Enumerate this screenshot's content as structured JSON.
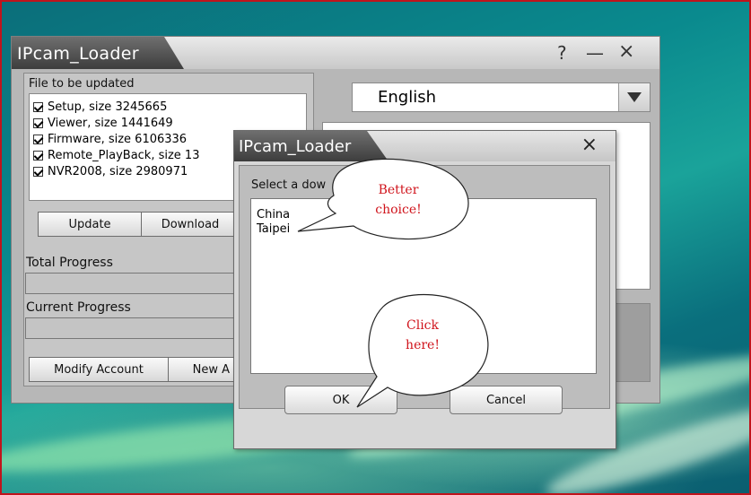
{
  "main_window": {
    "title": "IPcam_Loader",
    "controls": {
      "help": "?",
      "minimize": "—",
      "close": "×"
    },
    "file_section_label": "File to be updated",
    "files": [
      {
        "label": "Setup, size 3245665",
        "checked": true
      },
      {
        "label": "Viewer, size 1441649",
        "checked": true
      },
      {
        "label": "Firmware, size 6106336",
        "checked": true
      },
      {
        "label": "Remote_PlayBack, size 13",
        "checked": true
      },
      {
        "label": "NVR2008, size 2980971",
        "checked": true
      }
    ],
    "update_button": "Update",
    "download_button": "Download",
    "total_progress_label": "Total Progress",
    "current_progress_label": "Current Progress",
    "modify_account_button": "Modify Account",
    "new_account_button": "New A",
    "language_selected": "English"
  },
  "dialog": {
    "title": "IPcam_Loader",
    "close": "×",
    "prompt": "Select a dow",
    "options": [
      "China",
      "Taipei"
    ],
    "ok_button": "OK",
    "cancel_button": "Cancel"
  },
  "callouts": {
    "better_choice": [
      "Better",
      "choice!"
    ],
    "click_here": [
      "Click",
      "here!"
    ]
  },
  "colors": {
    "frame_border": "#c0141c",
    "callout_text": "#d0141c"
  }
}
